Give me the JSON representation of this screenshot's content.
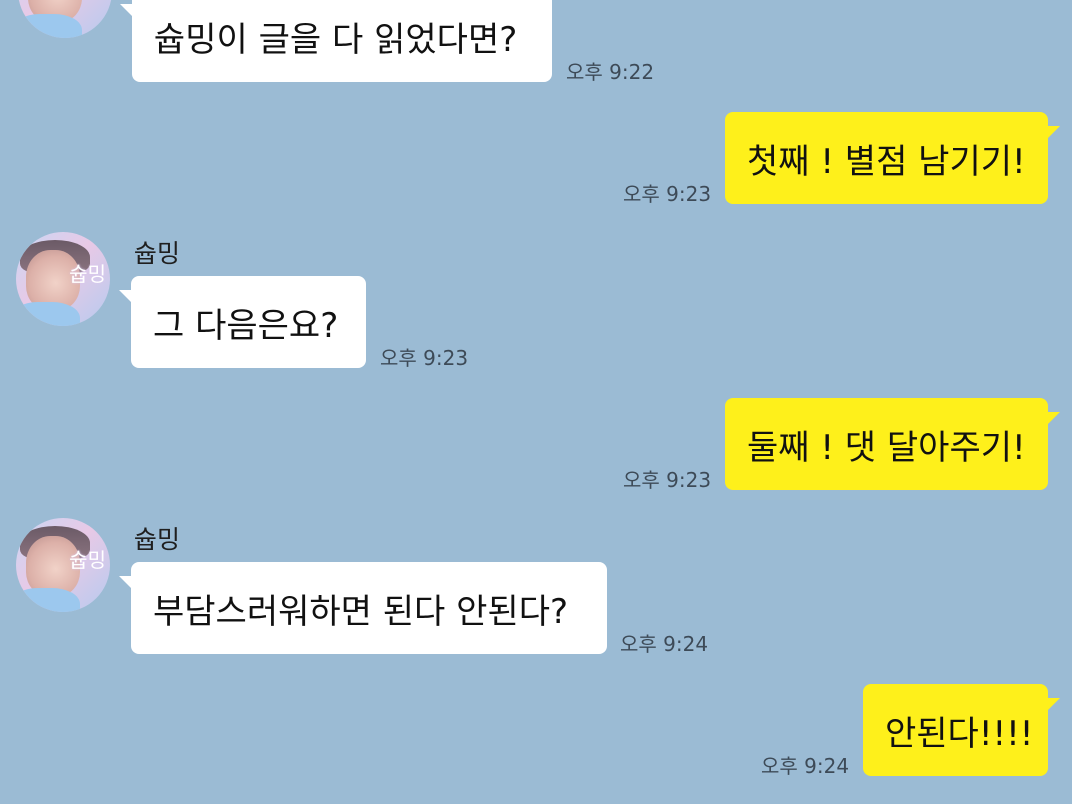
{
  "messages": [
    {
      "id": "m1",
      "direction": "incoming",
      "sender": "",
      "text": "슙밍이 글을 다 읽었다면?",
      "time": "오후 9:22"
    },
    {
      "id": "m2",
      "direction": "outgoing",
      "text": "첫째 ! 별점 남기기!",
      "time": "오후 9:23"
    },
    {
      "id": "m3",
      "direction": "incoming",
      "sender": "슙밍",
      "text": "그 다음은요?",
      "time": "오후 9:23"
    },
    {
      "id": "m4",
      "direction": "outgoing",
      "text": "둘째 ! 댓 달아주기!",
      "time": "오후 9:23"
    },
    {
      "id": "m5",
      "direction": "incoming",
      "sender": "슙밍",
      "text": "부담스러워하면 된다 안된다?",
      "time": "오후 9:24"
    },
    {
      "id": "m6",
      "direction": "outgoing",
      "text": "안된다!!!!",
      "time": "오후 9:24"
    }
  ],
  "avatar": {
    "overlay_text": "슙밍"
  },
  "colors": {
    "background": "#9bbbd4",
    "incoming_bubble": "#ffffff",
    "outgoing_bubble": "#fef01b",
    "timestamp": "#3d4a57"
  }
}
